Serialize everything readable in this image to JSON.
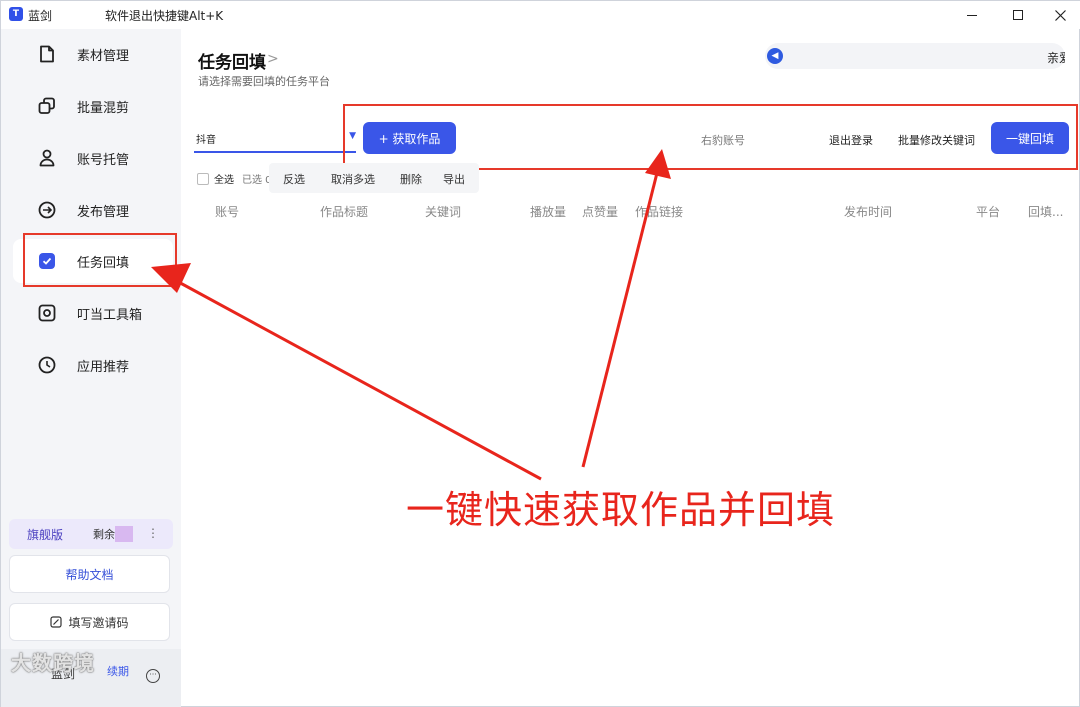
{
  "titlebar": {
    "app_name": "蓝剑",
    "hint": "软件退出快捷键Alt+K",
    "logo_glyph": "T"
  },
  "sidebar": {
    "items": [
      {
        "label": "素材管理",
        "icon": "file-icon"
      },
      {
        "label": "批量混剪",
        "icon": "copy-icon"
      },
      {
        "label": "账号托管",
        "icon": "user-icon"
      },
      {
        "label": "发布管理",
        "icon": "publish-icon"
      },
      {
        "label": "任务回填",
        "icon": "check-square-icon",
        "active": true
      },
      {
        "label": "叮当工具箱",
        "icon": "toolbox-icon"
      },
      {
        "label": "应用推荐",
        "icon": "recommend-icon"
      }
    ],
    "plan": {
      "name": "旗舰版",
      "remaining": "剩余",
      "more": "⋮"
    },
    "help_label": "帮助文档",
    "invite_label": "填写邀请码",
    "user": {
      "name": "蓝剑",
      "status": "续期",
      "more": "···"
    },
    "watermark": "大数跨境"
  },
  "header": {
    "title": "任务回填",
    "arrow": ">",
    "subtitle": "请选择需要回填的任务平台",
    "notice_icon": "◀",
    "notice_text": "亲爱"
  },
  "toolbar": {
    "platform_value": "抖音",
    "caret": "▼",
    "fetch_label": "+ 获取作品",
    "account_label": "右豹账号",
    "logout_label": "退出登录",
    "batch_label": "批量修改关键词",
    "onekey_label": "一键回填"
  },
  "selection": {
    "all_label": "全选",
    "selected_label": "已选 0",
    "actions": [
      "反选",
      "取消多选",
      "删除",
      "导出"
    ]
  },
  "table": {
    "columns": [
      "账号",
      "作品标题",
      "关键词",
      "播放量",
      "点赞量",
      "作品链接",
      "发布时间",
      "平台",
      "回填..."
    ]
  },
  "annotation": {
    "text": "一键快速获取作品并回填",
    "color": "#e8251c"
  },
  "colors": {
    "accent": "#3a56e8",
    "sidebar_bg": "#f4f5f8",
    "annotation_red": "#e6392a"
  }
}
